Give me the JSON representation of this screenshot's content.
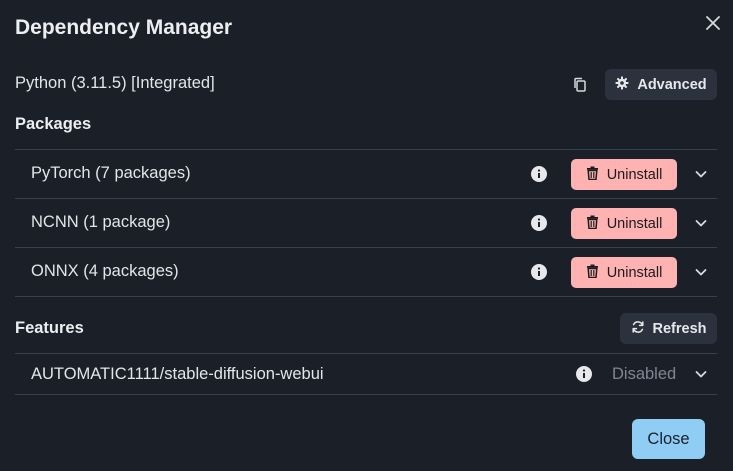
{
  "dialog": {
    "title": "Dependency Manager",
    "close_icon": "close-icon",
    "python_info": "Python (3.11.5) [Integrated]",
    "copy_icon": "copy-icon",
    "advanced_label": "Advanced",
    "advanced_icon": "gear-icon"
  },
  "packages": {
    "title": "Packages",
    "uninstall_label": "Uninstall",
    "items": [
      {
        "label": "PyTorch (7 packages)"
      },
      {
        "label": "NCNN (1 package)"
      },
      {
        "label": "ONNX (4 packages)"
      }
    ]
  },
  "features": {
    "title": "Features",
    "refresh_label": "Refresh",
    "refresh_icon": "refresh-icon",
    "items": [
      {
        "label": "AUTOMATIC1111/stable-diffusion-webui",
        "status": "Disabled"
      }
    ]
  },
  "footer": {
    "close_label": "Close"
  },
  "colors": {
    "background": "#1b1f27",
    "uninstall_bg": "#feb2b2",
    "close_bg": "#90cdf4",
    "button_dark": "#2c323d",
    "disabled_text": "#7f8693"
  }
}
